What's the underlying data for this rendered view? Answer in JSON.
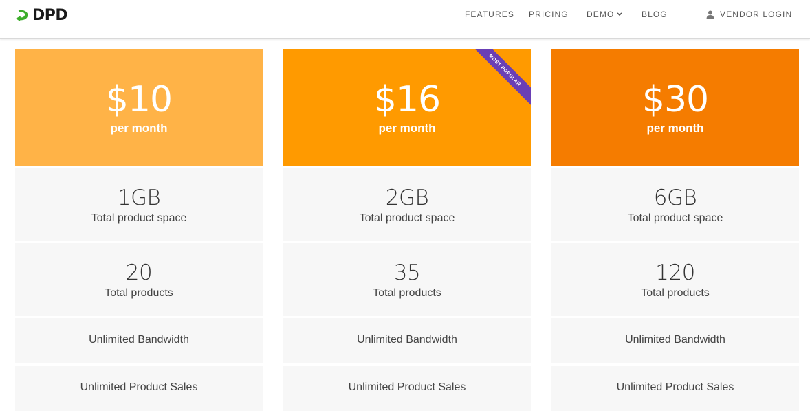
{
  "brand": {
    "name": "DPD"
  },
  "nav": {
    "features": "FEATURES",
    "pricing": "PRICING",
    "demo": "DEMO",
    "blog": "BLOG",
    "vendor_login": "VENDOR LOGIN"
  },
  "plans": [
    {
      "price": "$10",
      "period": "per month",
      "color": "#FFB347",
      "space_value": "1GB",
      "space_label": "Total product space",
      "products_value": "20",
      "products_label": "Total products",
      "bandwidth": "Unlimited Bandwidth",
      "sales": "Unlimited Product Sales"
    },
    {
      "price": "$16",
      "period": "per month",
      "color": "#FF9A00",
      "ribbon": "MOST POPULAR",
      "space_value": "2GB",
      "space_label": "Total product space",
      "products_value": "35",
      "products_label": "Total products",
      "bandwidth": "Unlimited Bandwidth",
      "sales": "Unlimited Product Sales"
    },
    {
      "price": "$30",
      "period": "per month",
      "color": "#F57C00",
      "space_value": "6GB",
      "space_label": "Total product space",
      "products_value": "120",
      "products_label": "Total products",
      "bandwidth": "Unlimited Bandwidth",
      "sales": "Unlimited Product Sales"
    }
  ],
  "colors": {
    "brand_green": "#3DAE2B",
    "ribbon": "#6A3FB5",
    "feature_bg": "#F7F7F7"
  }
}
